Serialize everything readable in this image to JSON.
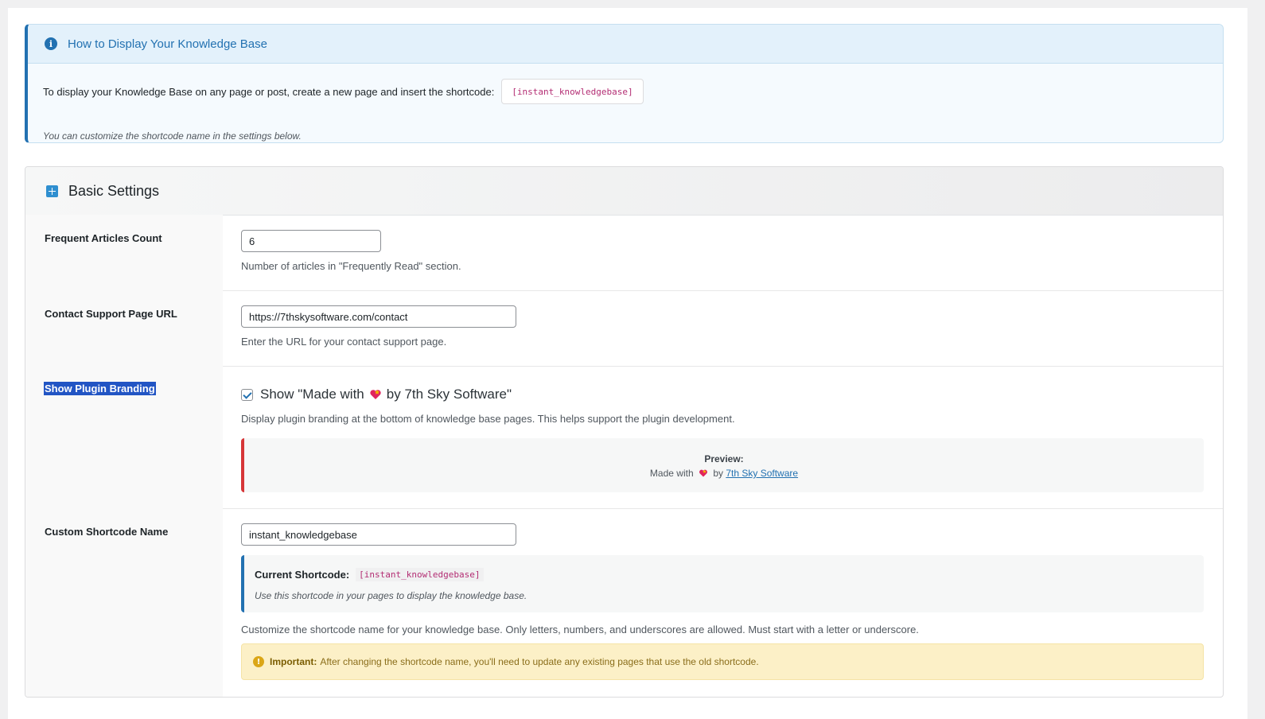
{
  "notice": {
    "title": "How to Display Your Knowledge Base",
    "instruction": "To display your Knowledge Base on any page or post, create a new page and insert the shortcode:",
    "shortcode": "[instant_knowledgebase]",
    "note": "You can customize the shortcode name in the settings below."
  },
  "panel": {
    "title": "Basic Settings"
  },
  "settings": {
    "frequent_articles": {
      "label": "Frequent Articles Count",
      "value": "6",
      "description": "Number of articles in \"Frequently Read\" section."
    },
    "contact_url": {
      "label": "Contact Support Page URL",
      "value": "https://7thskysoftware.com/contact",
      "description": "Enter the URL for your contact support page."
    },
    "branding": {
      "label": "Show Plugin Branding",
      "checked": true,
      "checkbox_prefix": "Show \"Made with",
      "checkbox_suffix": "by 7th Sky Software\"",
      "description": "Display plugin branding at the bottom of knowledge base pages. This helps support the plugin development.",
      "preview_title": "Preview:",
      "preview_prefix": "Made with",
      "preview_by": "by",
      "preview_link": "7th Sky Software"
    },
    "shortcode_name": {
      "label": "Custom Shortcode Name",
      "value": "instant_knowledgebase",
      "current_label": "Current Shortcode:",
      "current_value": "[instant_knowledgebase]",
      "current_note": "Use this shortcode in your pages to display the knowledge base.",
      "description": "Customize the shortcode name for your knowledge base. Only letters, numbers, and underscores are allowed. Must start with a letter or underscore.",
      "warning_strong": "Important:",
      "warning_text": "After changing the shortcode name, you'll need to update any existing pages that use the old shortcode."
    }
  },
  "colors": {
    "accent": "#2271b1",
    "danger": "#d63638",
    "warning_bg": "#fcf0c7"
  }
}
